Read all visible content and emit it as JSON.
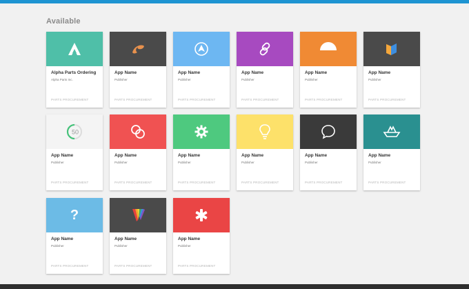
{
  "section_title": "Available",
  "colors": {
    "top_bar": "#1e94d2",
    "bottom_bar": "#2e2e2e",
    "background": "#f1f1f1"
  },
  "apps": [
    {
      "name": "Alpha Parts Ordering",
      "publisher": "Alpha Parts Inc.",
      "category": "PARTS PROCUREMENT",
      "banner_color": "#4fbfa8",
      "icon": "mountain-a-icon"
    },
    {
      "name": "App Name",
      "publisher": "Publisher",
      "category": "PARTS PROCUREMENT",
      "banner_color": "#4a4a4a",
      "icon": "orange-swoosh-icon"
    },
    {
      "name": "App Name",
      "publisher": "Publisher",
      "category": "PARTS PROCUREMENT",
      "banner_color": "#6db7f2",
      "icon": "navigation-arrow-icon"
    },
    {
      "name": "App Name",
      "publisher": "Publisher",
      "category": "PARTS PROCUREMENT",
      "banner_color": "#a74ac0",
      "icon": "link-icon"
    },
    {
      "name": "App Name",
      "publisher": "Publisher",
      "category": "PARTS PROCUREMENT",
      "banner_color": "#f08a34",
      "icon": "half-circle-icon"
    },
    {
      "name": "App Name",
      "publisher": "Publisher",
      "category": "PARTS PROCUREMENT",
      "banner_color": "#4a4a4a",
      "icon": "book-icon"
    },
    {
      "name": "App Name",
      "publisher": "Publisher",
      "category": "PARTS PROCUREMENT",
      "banner_color": "#f4f4f4",
      "icon": "progress-ring-icon",
      "icon_text": "50"
    },
    {
      "name": "App Name",
      "publisher": "Publisher",
      "category": "PARTS PROCUREMENT",
      "banner_color": "#f05252",
      "icon": "rings-icon"
    },
    {
      "name": "App Name",
      "publisher": "Publisher",
      "category": "PARTS PROCUREMENT",
      "banner_color": "#4ec97f",
      "icon": "gear-icon"
    },
    {
      "name": "App Name",
      "publisher": "Publisher",
      "category": "PARTS PROCUREMENT",
      "banner_color": "#fde16a",
      "icon": "lightbulb-icon"
    },
    {
      "name": "App Name",
      "publisher": "Publisher",
      "category": "PARTS PROCUREMENT",
      "banner_color": "#3a3a3a",
      "icon": "chat-bubble-icon"
    },
    {
      "name": "App Name",
      "publisher": "Publisher",
      "category": "PARTS PROCUREMENT",
      "banner_color": "#2a9090",
      "icon": "paper-boat-icon"
    },
    {
      "name": "App Name",
      "publisher": "Publisher",
      "category": "PARTS PROCUREMENT",
      "banner_color": "#6cbbe6",
      "icon": "question-icon",
      "icon_text": "?"
    },
    {
      "name": "App Name",
      "publisher": "Publisher",
      "category": "PARTS PROCUREMENT",
      "banner_color": "#4a4a4a",
      "icon": "rainbow-v-icon"
    },
    {
      "name": "App Name",
      "publisher": "Publisher",
      "category": "PARTS PROCUREMENT",
      "banner_color": "#ea4545",
      "icon": "asterisk-icon"
    }
  ]
}
